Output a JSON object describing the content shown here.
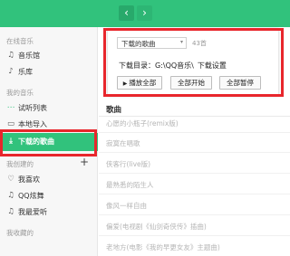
{
  "colors": {
    "accent": "#31c27c",
    "highlight_box": "#e8262c"
  },
  "toolbar": {
    "back_icon": "‹",
    "forward_icon": "›"
  },
  "sidebar": {
    "online_title": "在线音乐",
    "online_items": [
      {
        "icon": "♫",
        "label": "音乐馆"
      },
      {
        "icon": "♪",
        "label": "乐库"
      }
    ],
    "my_music_title": "我的音乐",
    "my_items": [
      {
        "icon": "⋯",
        "label": "试听列表"
      },
      {
        "icon": "▭",
        "label": "本地导入"
      },
      {
        "icon": "⤓",
        "label": "下载的歌曲"
      }
    ],
    "playlists_title": "我创建的",
    "add_icon": "+",
    "playlist_items": [
      {
        "icon": "♡",
        "label": "我喜欢"
      },
      {
        "icon": "♫",
        "label": "QQ炫舞"
      },
      {
        "icon": "♫",
        "label": "我最爱听"
      }
    ],
    "favorites_title": "我收藏的"
  },
  "main": {
    "column_header": "歌曲",
    "songs": [
      "心愿的小瓶子(remix版)",
      "寂寞在唱歌",
      "侠客行(live版)",
      "最熟悉的陌生人",
      "像风一样自由",
      "偏爱(电视剧《仙剑奇侠传》插曲)",
      "老地方(电影《我的早更女友》主题曲)"
    ]
  },
  "popup": {
    "selected_option": "下载的歌曲",
    "dropdown_arrow": "▾",
    "count": "43首",
    "dir_label": "下载目录：G:\\QQ音乐\\",
    "settings_link": "下载设置",
    "buttons": {
      "pause_all": "播放全部",
      "start_all": "全部开始",
      "stop_all": "全部暂停"
    },
    "play_icon": "▶"
  }
}
